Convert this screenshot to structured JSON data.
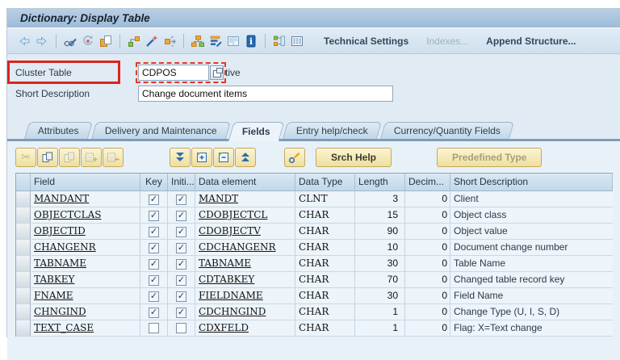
{
  "window": {
    "title": "Dictionary: Display Table"
  },
  "main_toolbar": {
    "icons": [
      "back-icon",
      "forward-icon",
      "display-change-icon",
      "refresh-icon",
      "copy-as-icon",
      "where-used-icon",
      "wand-icon",
      "forward-routing-icon",
      "hierarchy-icon",
      "sorted-list-icon",
      "display-list-icon",
      "info-icon",
      "object-list-icon",
      "table-view-icon"
    ],
    "text_buttons": [
      {
        "label": "Technical Settings",
        "enabled": true
      },
      {
        "label": "Indexes...",
        "enabled": false
      },
      {
        "label": "Append Structure...",
        "enabled": true
      }
    ]
  },
  "form": {
    "cluster_table_label": "Cluster Table",
    "cluster_table_value": "CDPOS",
    "active_status_fragment": "tive",
    "short_description_label": "Short Description",
    "short_description_value": "Change document items"
  },
  "tabs": [
    {
      "label": "Attributes",
      "active": false
    },
    {
      "label": "Delivery and Maintenance",
      "active": false
    },
    {
      "label": "Fields",
      "active": true
    },
    {
      "label": "Entry help/check",
      "active": false
    },
    {
      "label": "Currency/Quantity Fields",
      "active": false
    }
  ],
  "table_toolbar": {
    "icon_buttons": [
      "cut-icon",
      "copy-icon",
      "paste-icon",
      "insert-row-icon",
      "delete-row-icon",
      "move-down-icon",
      "insert-entry-icon",
      "delete-entry-icon",
      "move-up-icon",
      "search-key-icon"
    ],
    "srch_help_label": "Srch Help",
    "predefined_type_label": "Predefined Type"
  },
  "table": {
    "columns": {
      "field": "Field",
      "key": "Key",
      "initial": "Initi...",
      "data_element": "Data element",
      "data_type": "Data Type",
      "length": "Length",
      "decimals": "Decim...",
      "description": "Short Description"
    },
    "rows": [
      {
        "field": "MANDANT",
        "key": true,
        "initial": true,
        "data_element": "MANDT",
        "data_type": "CLNT",
        "length": "3",
        "decimals": "0",
        "description": "Client"
      },
      {
        "field": "OBJECTCLAS",
        "key": true,
        "initial": true,
        "data_element": "CDOBJECTCL",
        "data_type": "CHAR",
        "length": "15",
        "decimals": "0",
        "description": "Object class"
      },
      {
        "field": "OBJECTID",
        "key": true,
        "initial": true,
        "data_element": "CDOBJECTV",
        "data_type": "CHAR",
        "length": "90",
        "decimals": "0",
        "description": "Object value"
      },
      {
        "field": "CHANGENR",
        "key": true,
        "initial": true,
        "data_element": "CDCHANGENR",
        "data_type": "CHAR",
        "length": "10",
        "decimals": "0",
        "description": "Document change number"
      },
      {
        "field": "TABNAME",
        "key": true,
        "initial": true,
        "data_element": "TABNAME",
        "data_type": "CHAR",
        "length": "30",
        "decimals": "0",
        "description": "Table Name"
      },
      {
        "field": "TABKEY",
        "key": true,
        "initial": true,
        "data_element": "CDTABKEY",
        "data_type": "CHAR",
        "length": "70",
        "decimals": "0",
        "description": "Changed table record key"
      },
      {
        "field": "FNAME",
        "key": true,
        "initial": true,
        "data_element": "FIELDNAME",
        "data_type": "CHAR",
        "length": "30",
        "decimals": "0",
        "description": "Field Name"
      },
      {
        "field": "CHNGIND",
        "key": true,
        "initial": true,
        "data_element": "CDCHNGIND",
        "data_type": "CHAR",
        "length": "1",
        "decimals": "0",
        "description": "Change Type (U, I, S, D)"
      },
      {
        "field": "TEXT_CASE",
        "key": false,
        "initial": false,
        "data_element": "CDXFELD",
        "data_type": "CHAR",
        "length": "1",
        "decimals": "0",
        "description": "Flag: X=Text change"
      }
    ]
  },
  "colors": {
    "annotation_red": "#dc241b",
    "button_yellow": "#f2e3a4",
    "titlebar_blue": "#a7c1dc",
    "panel_blue": "#e9f1f8"
  }
}
